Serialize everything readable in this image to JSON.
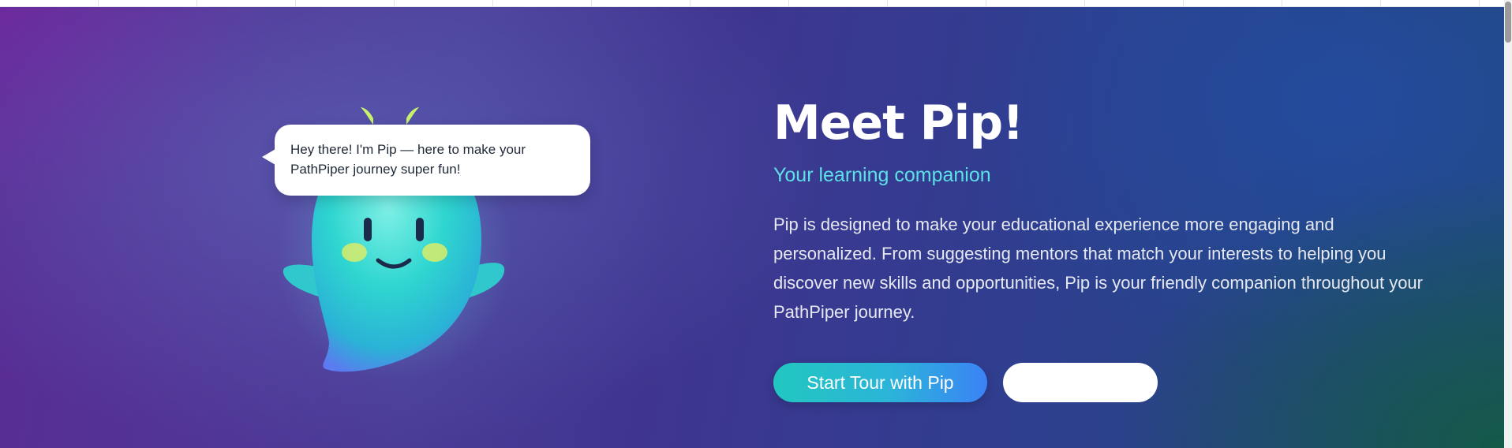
{
  "hero": {
    "speech_bubble": "Hey there! I'm Pip — here to make your PathPiper journey super fun!",
    "title": "Meet Pip!",
    "subtitle": "Your learning companion",
    "description": "Pip is designed to make your educational experience more engaging and personalized. From suggesting mentors that match your interests to helping you discover new skills and opportunities, Pip is your friendly companion throughout your PathPiper journey.",
    "primary_button": "Start Tour with Pip",
    "secondary_button": ""
  },
  "colors": {
    "subtitle": "#5ce1e6",
    "primary_button_start": "#22c7c0",
    "primary_button_end": "#3b82f6",
    "mascot_body": "#2fd6d0",
    "mascot_sprout": "#c8f26a"
  },
  "icons": {
    "mascot": "pip-ghost-mascot"
  }
}
